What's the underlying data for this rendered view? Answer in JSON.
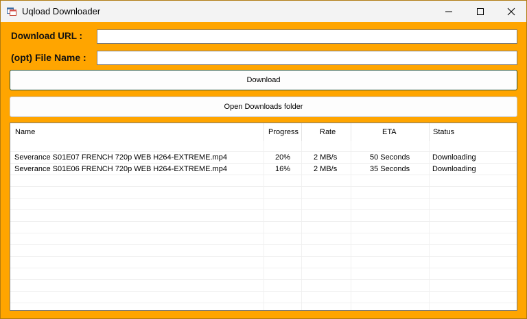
{
  "window": {
    "title": "Uqload Downloader"
  },
  "form": {
    "url_label": "Download URL :",
    "url_value": "",
    "filename_label": "(opt) File Name :",
    "filename_value": ""
  },
  "buttons": {
    "download": "Download",
    "open_folder": "Open Downloads folder"
  },
  "list": {
    "columns": [
      "Name",
      "Progress",
      "Rate",
      "ETA",
      "Status"
    ],
    "rows": [
      {
        "name": "Severance S01E07 FRENCH 720p WEB H264-EXTREME.mp4",
        "progress": "20%",
        "rate": "2 MB/s",
        "eta": "50 Seconds",
        "status": "Downloading"
      },
      {
        "name": "Severance S01E06 FRENCH 720p WEB H264-EXTREME.mp4",
        "progress": "16%",
        "rate": "2 MB/s",
        "eta": "35 Seconds",
        "status": "Downloading"
      }
    ]
  },
  "colors": {
    "background": "#ffa500",
    "titlebar": "#f3f3f3"
  },
  "icons": {
    "app": "app-window-icon",
    "minimize": "minimize-icon",
    "maximize": "maximize-icon",
    "close": "close-icon"
  }
}
